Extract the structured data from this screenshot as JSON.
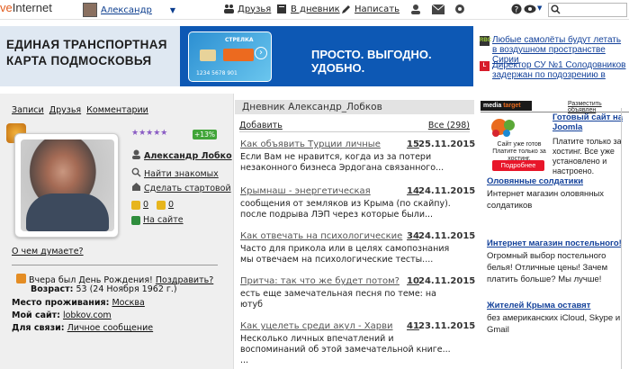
{
  "header": {
    "logo_a": "ve",
    "logo_b": "Internet",
    "user": "Александр",
    "nav": [
      "Друзья",
      "В дневник",
      "Написать"
    ],
    "colors": {
      "accent": "#e25a1c",
      "link": "#0b3d8e"
    }
  },
  "banner": {
    "line1": "ЕДИНАЯ ТРАНСПОРТНАЯ",
    "line2": "КАРТА ПОДМОСКОВЬЯ",
    "card_text": "СТРЕЛКА",
    "card_digits": "1234  5678  901",
    "slogan": "ПРОСТО. ВЫГОДНО. УДОБНО."
  },
  "news": [
    {
      "icon": "rbc-icon",
      "text": "Любые самолёты будут летать в воздушном пространстве Сирии"
    },
    {
      "icon": "life-icon",
      "text": "Директор СУ №1 Солодовников задержан по подозрению в"
    }
  ],
  "left": {
    "tabs": [
      "Записи",
      "Друзья",
      "Комментарии"
    ],
    "stars": "★★★★★",
    "plus": "+13%",
    "name": "Александр Лобко",
    "find_friends": "Найти знакомых",
    "make_start": "Сделать стартовой",
    "likes": "0",
    "dislikes": "0",
    "on_site": "На сайте",
    "thought": "О чем думаете?",
    "birthday": "Вчера был День Рождения!",
    "congratulate": "Поздравить?",
    "age_label": "Возраст:",
    "age": "53 (24 Ноября 1962 г.)",
    "residence_label": "Место проживания:",
    "residence": "Москва",
    "site_label": "Мой сайт:",
    "site": "lobkov.com",
    "contact_label": "Для связи:",
    "contact": "Личное сообщение"
  },
  "diary": {
    "title": "Дневник Александр_Лобков",
    "add": "Добавить",
    "all": "Все (298)",
    "posts": [
      {
        "title": "Как объявить Турции личные",
        "count": "15",
        "date": "25.11.2015",
        "body": "Если Вам не нравится, когда из за потери незаконного бизнеса Эрдогана связанного..."
      },
      {
        "title": "Крымнаш - энергетическая",
        "count": "14",
        "date": "24.11.2015",
        "body": "сообщения от земляков из Крыма (по скайпу). после подрыва ЛЭП через которые были..."
      },
      {
        "title": "Как отвечать на психологические",
        "count": "34",
        "date": "24.11.2015",
        "body": "Часто для прикола или в целях самопознания мы отвечаем на психологические тесты...."
      },
      {
        "title": "Притча: так что же будет потом?",
        "count": "10",
        "date": "24.11.2015",
        "body": "есть еще замечательная песня по теме: на ютуб"
      },
      {
        "title": "Как уцелеть среди акул - Харви",
        "count": "41",
        "date": "23.11.2015",
        "body": "Несколько личных впечатлений и воспоминаний об этой замечательной книге... ..."
      }
    ]
  },
  "right": {
    "mt_a": "media",
    "mt_b": "target",
    "place": "Разместить объявлен",
    "ad_caption": "Сайт уже готов\nПлатите только за хостинг.",
    "ad_btn": "Подробнее",
    "ad_head": "Готовый сайт на Joomla",
    "ad_text": "Платите только за хостинг. Все уже установлено и настроено.",
    "ads": [
      {
        "h": "Оловянные солдатики",
        "t": "Интернет магазин оловянных солдатиков"
      },
      {
        "h": "Интернет магазин постельного!",
        "t": "Огромный выбор постельного белья! Отличные цены! Зачем платить больше? Мы лучше!"
      },
      {
        "h": "Жителей Крыма оставят",
        "t": "без американских iCloud, Skype и Gmail"
      }
    ]
  }
}
